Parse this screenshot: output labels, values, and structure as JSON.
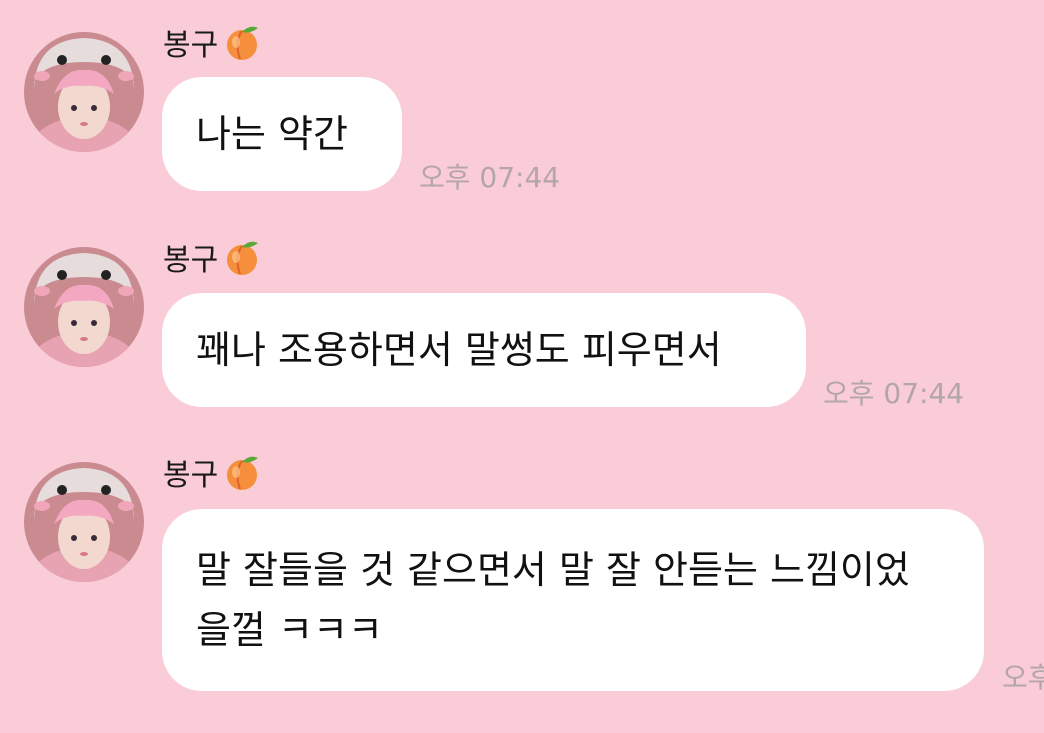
{
  "colors": {
    "background": "#f9ccd8",
    "bubble": "#ffffff",
    "timestamp": "#b3a5aa"
  },
  "messages": [
    {
      "sender": "봉구",
      "sender_icon": "peach-icon",
      "text": "나는 약간",
      "time": "오후 07:44"
    },
    {
      "sender": "봉구",
      "sender_icon": "peach-icon",
      "text": "꽤나 조용하면서 말썽도 피우면서",
      "time": "오후 07:44"
    },
    {
      "sender": "봉구",
      "sender_icon": "peach-icon",
      "text": "말 잘들을 것 같으면서 말 잘 안듣는 느낌이었\n을껄 ㅋㅋㅋ",
      "time": "오후"
    }
  ]
}
